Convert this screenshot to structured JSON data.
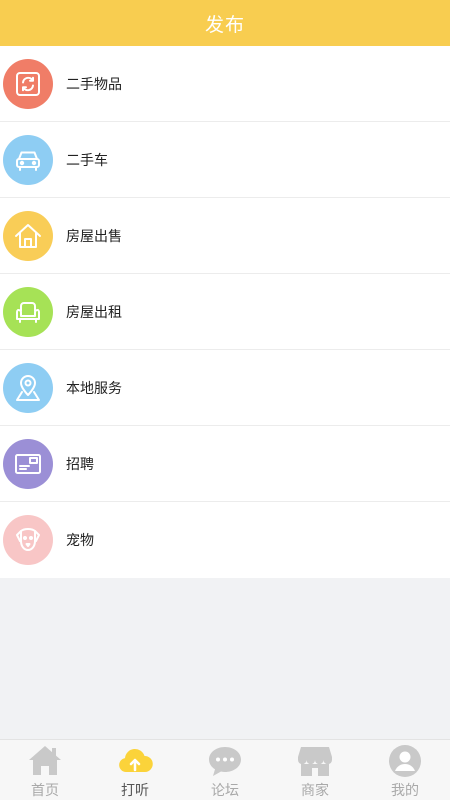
{
  "header": {
    "title": "发布"
  },
  "categories": [
    {
      "label": "二手物品",
      "icon": "refresh-box-icon",
      "color": "#f07d67"
    },
    {
      "label": "二手车",
      "icon": "car-icon",
      "color": "#8ecdf3"
    },
    {
      "label": "房屋出售",
      "icon": "house-icon",
      "color": "#f9cd57"
    },
    {
      "label": "房屋出租",
      "icon": "sofa-icon",
      "color": "#a6e256"
    },
    {
      "label": "本地服务",
      "icon": "location-pin-icon",
      "color": "#8ecdf3"
    },
    {
      "label": "招聘",
      "icon": "id-card-icon",
      "color": "#9b8fd6"
    },
    {
      "label": "宠物",
      "icon": "dog-face-icon",
      "color": "#f8c6c6"
    }
  ],
  "tabbar": {
    "items": [
      {
        "label": "首页",
        "icon": "home-icon"
      },
      {
        "label": "打听",
        "icon": "cloud-upload-icon",
        "active": true,
        "color": "#fbd33a"
      },
      {
        "label": "论坛",
        "icon": "chat-bubble-icon"
      },
      {
        "label": "商家",
        "icon": "store-icon"
      },
      {
        "label": "我的",
        "icon": "user-icon"
      }
    ]
  }
}
